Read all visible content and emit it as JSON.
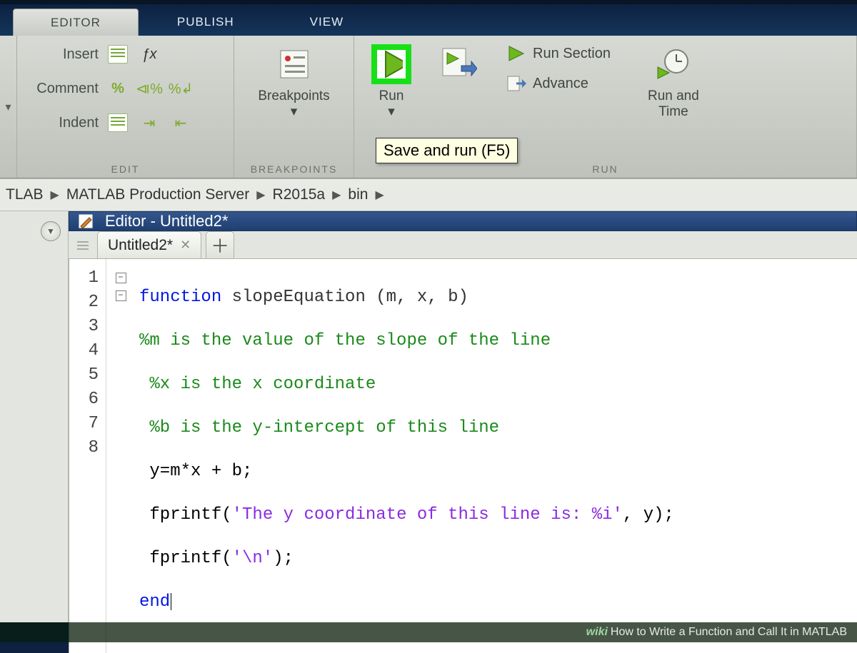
{
  "tabs": {
    "editor": "EDITOR",
    "publish": "PUBLISH",
    "view": "VIEW"
  },
  "edit_group": {
    "label": "EDIT",
    "rows": [
      {
        "label": "Insert",
        "icons": [
          "insert-section-icon",
          "fx-icon",
          "blank"
        ]
      },
      {
        "label": "Comment",
        "icons": [
          "percent-icon",
          "percent-braces-icon",
          "percent-wrap-icon"
        ]
      },
      {
        "label": "Indent",
        "icons": [
          "indent-icon",
          "outdent-icon",
          "blank"
        ]
      }
    ]
  },
  "breakpoints_group": {
    "label": "BREAKPOINTS",
    "button": "Breakpoints"
  },
  "run_group": {
    "label": "RUN",
    "run": "Run",
    "run_section": "Run Section",
    "advance": "Advance",
    "run_and_time": "Run and\nTime"
  },
  "tooltip": "Save and run (F5)",
  "breadcrumb": [
    "TLAB",
    "MATLAB Production Server",
    "R2015a",
    "bin"
  ],
  "panel_title": "Editor - Untitled2*",
  "doc_tab": "Untitled2*",
  "code_lines": [
    1,
    2,
    3,
    4,
    5,
    6,
    7,
    8
  ],
  "code": {
    "l1a": "function",
    "l1b": " slopeEquation (m, x, b)",
    "l2": "%m is the value of the slope of the line",
    "l3": "%x is the x coordinate",
    "l4": "%b is the y-intercept of this line",
    "l5": "y=m*x + b;",
    "l6a": "fprintf(",
    "l6b": "'The y coordinate of this line is: %i'",
    "l6c": ", y);",
    "l7a": "fprintf(",
    "l7b": "'\\n'",
    "l7c": ");",
    "l8": "end"
  },
  "footer": {
    "wiki": "wiki",
    "title": "How to Write a Function and Call It in MATLAB"
  }
}
